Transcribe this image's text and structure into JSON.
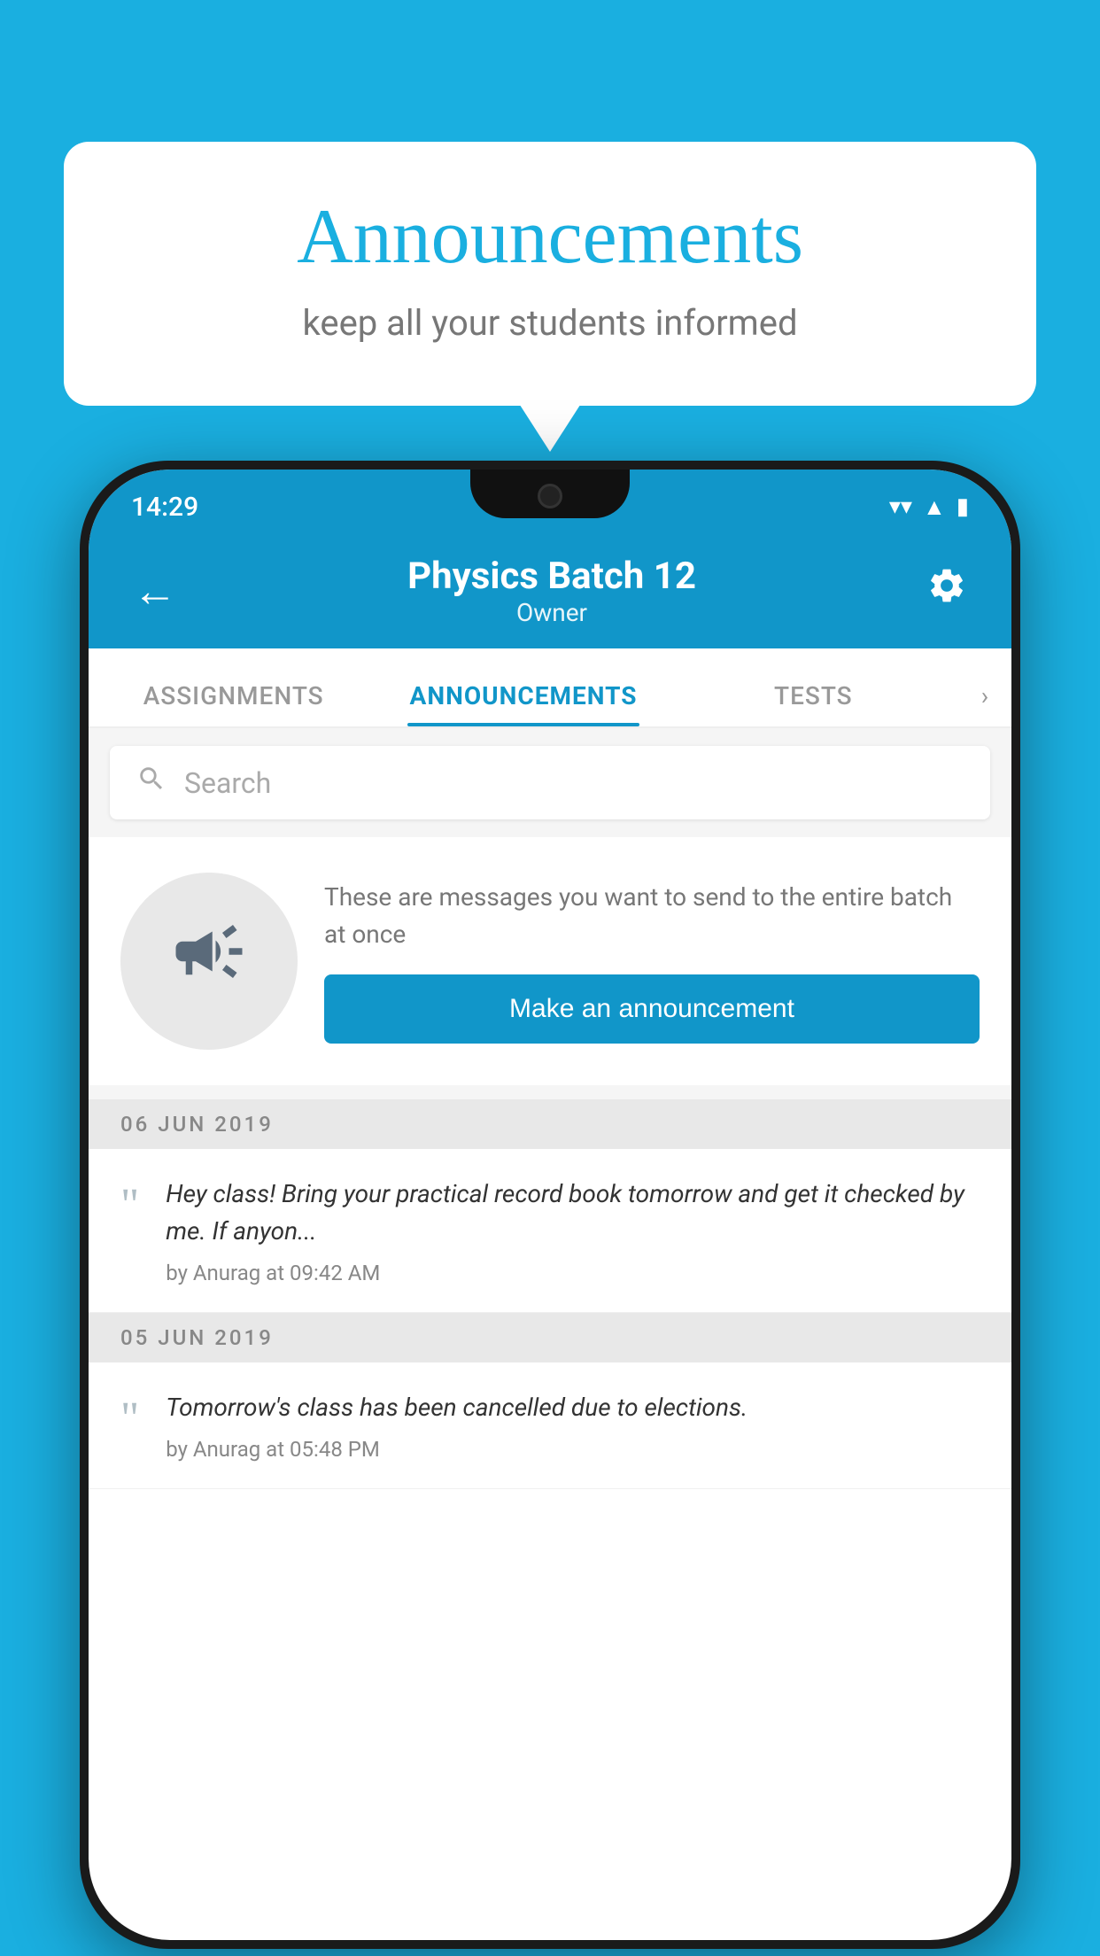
{
  "background_color": "#1AAFE0",
  "speech_bubble": {
    "title": "Announcements",
    "subtitle": "keep all your students informed"
  },
  "phone": {
    "status_bar": {
      "time": "14:29",
      "wifi": "▼",
      "signal": "▲",
      "battery": "▮"
    },
    "header": {
      "back_label": "←",
      "title": "Physics Batch 12",
      "subtitle": "Owner",
      "gear_label": "⚙"
    },
    "tabs": [
      {
        "label": "ASSIGNMENTS",
        "active": false
      },
      {
        "label": "ANNOUNCEMENTS",
        "active": true
      },
      {
        "label": "TESTS",
        "active": false
      }
    ],
    "search": {
      "placeholder": "Search"
    },
    "promo_card": {
      "description": "These are messages you want to send to the entire batch at once",
      "button_label": "Make an announcement"
    },
    "announcements": [
      {
        "date": "06  JUN  2019",
        "text": "Hey class! Bring your practical record book tomorrow and get it checked by me. If anyon...",
        "meta": "by Anurag at 09:42 AM"
      },
      {
        "date": "05  JUN  2019",
        "text": "Tomorrow's class has been cancelled due to elections.",
        "meta": "by Anurag at 05:48 PM"
      }
    ]
  }
}
